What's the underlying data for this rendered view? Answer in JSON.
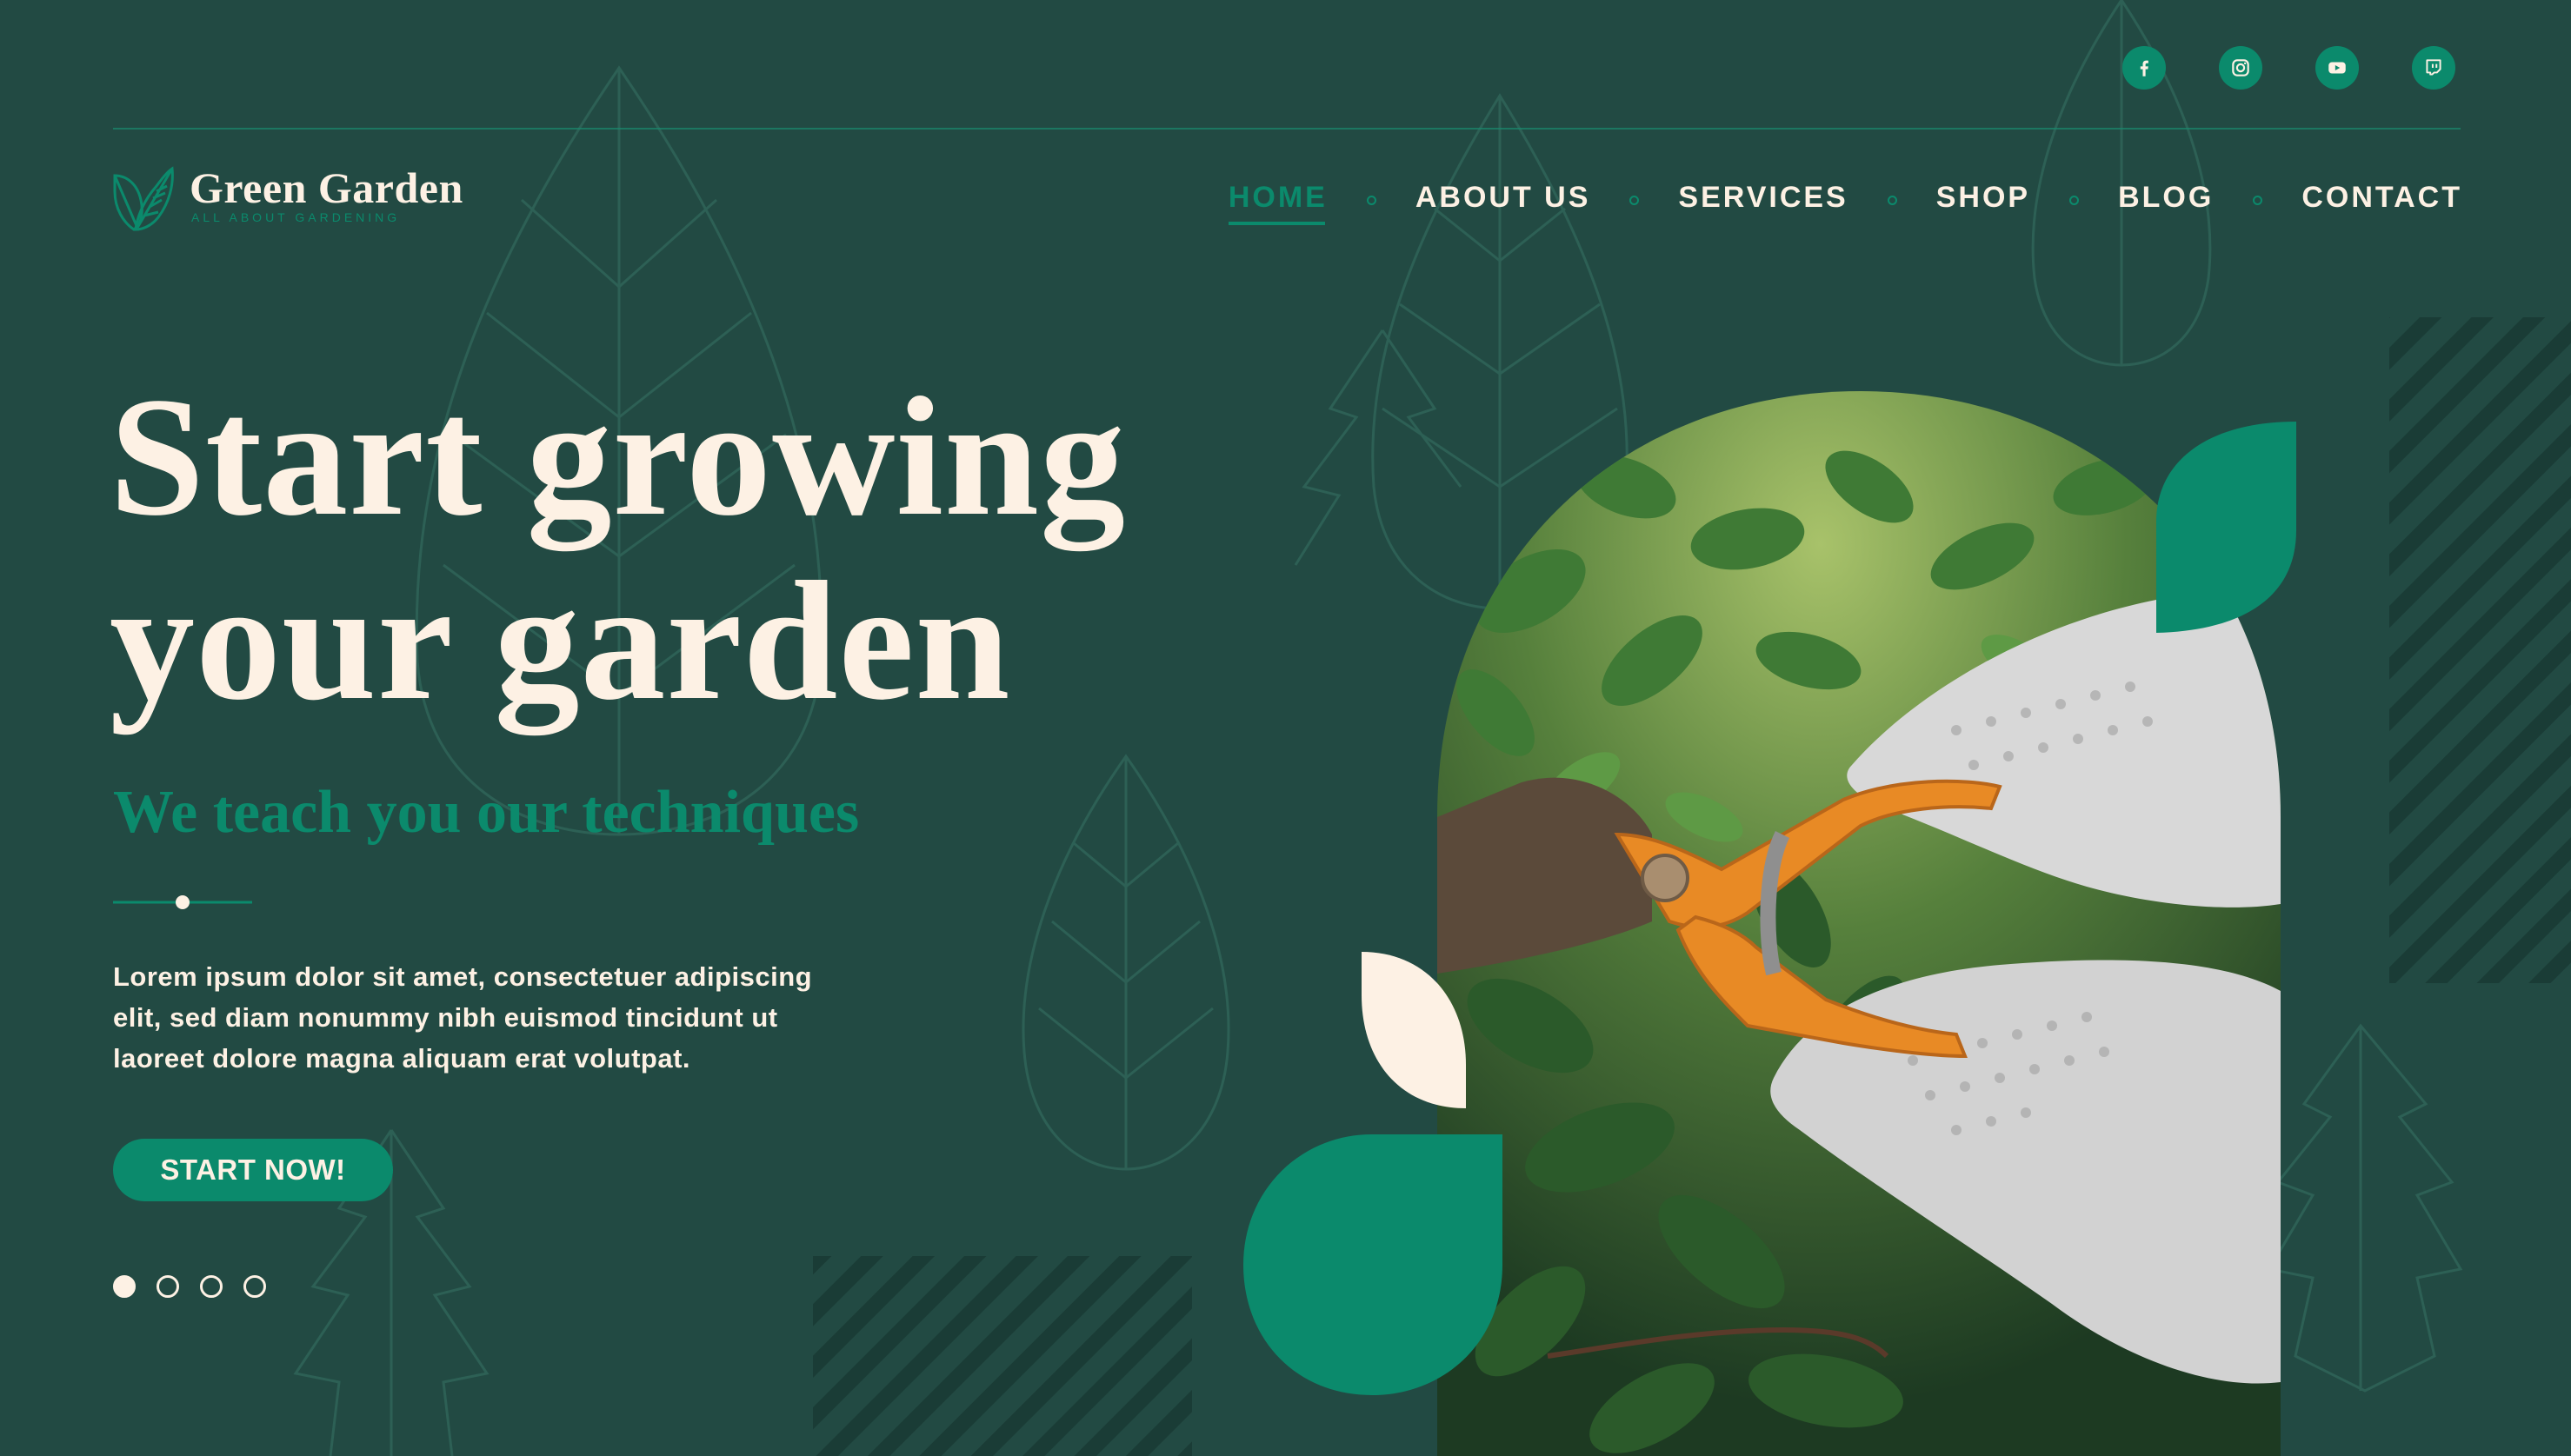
{
  "colors": {
    "background": "#224a43",
    "accent": "#0b8a6c",
    "cream": "#fdf1e4"
  },
  "social": [
    {
      "name": "facebook-icon"
    },
    {
      "name": "instagram-icon"
    },
    {
      "name": "youtube-icon"
    },
    {
      "name": "twitch-icon"
    }
  ],
  "logo": {
    "name": "Green Garden",
    "tagline": "ALL ABOUT GARDENING"
  },
  "nav": {
    "items": [
      {
        "label": "HOME",
        "active": true
      },
      {
        "label": "ABOUT US"
      },
      {
        "label": "SERVICES"
      },
      {
        "label": "SHOP"
      },
      {
        "label": "BLOG"
      },
      {
        "label": "CONTACT"
      }
    ]
  },
  "hero": {
    "title_line1": "Start growing",
    "title_line2": "your garden",
    "subtitle": "We teach you our techniques",
    "body_line1": "Lorem ipsum dolor sit amet, consectetuer adipiscing",
    "body_line2": "elit, sed diam nonummy nibh euismod tincidunt ut",
    "body_line3": "laoreet dolore magna aliquam erat volutpat.",
    "cta_label": "START NOW!",
    "image_subject": "gloved hands pruning shrubs with orange shears"
  },
  "pager": {
    "total": 4,
    "active_index": 0
  }
}
